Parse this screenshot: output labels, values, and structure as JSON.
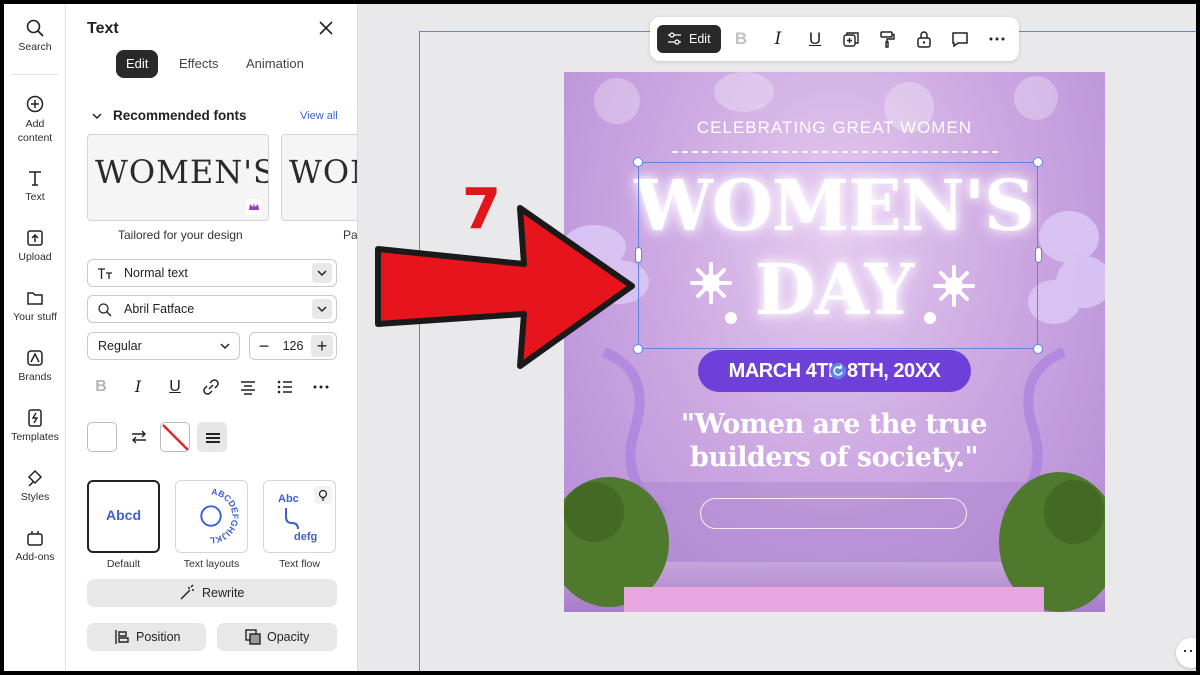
{
  "rail": {
    "items": [
      {
        "label": "Search",
        "icon": "search-icon"
      },
      {
        "label": "Add content",
        "icon": "add-content-icon"
      },
      {
        "label": "Text",
        "icon": "text-icon"
      },
      {
        "label": "Upload",
        "icon": "upload-icon"
      },
      {
        "label": "Your stuff",
        "icon": "folder-icon"
      },
      {
        "label": "Brands",
        "icon": "brands-icon"
      },
      {
        "label": "Templates",
        "icon": "templates-icon"
      },
      {
        "label": "Styles",
        "icon": "styles-icon"
      },
      {
        "label": "Add-ons",
        "icon": "add-ons-icon"
      }
    ]
  },
  "panel": {
    "title": "Text",
    "tabs": [
      "Edit",
      "Effects",
      "Animation"
    ],
    "active_tab": "Edit",
    "recommended_header": "Recommended fonts",
    "view_all": "View all",
    "font_cards": [
      {
        "sample": "WOMEN'S D",
        "label": "Tailored for your design"
      },
      {
        "sample": "WOM",
        "label": "Pa"
      }
    ],
    "text_type": "Normal text",
    "font_family": "Abril Fatface",
    "font_weight": "Regular",
    "font_size": "126",
    "presets": [
      {
        "label": "Default",
        "preview": "Abcd"
      },
      {
        "label": "Text layouts",
        "preview": "ABCDEFGHIJKL"
      },
      {
        "label": "Text flow",
        "preview_top": "Abc",
        "preview_bottom": "defg"
      }
    ],
    "rewrite_label": "Rewrite",
    "position_label": "Position",
    "opacity_label": "Opacity"
  },
  "toolbar": {
    "edit_label": "Edit"
  },
  "poster": {
    "headline": "CELEBRATING GREAT WOMEN",
    "title_line1": "WOMEN'S",
    "title_line2": "DAY",
    "date": "MARCH 4TH 8TH, 20XX",
    "quote_line1": "\"Women are the true",
    "quote_line2": "builders of society.\""
  },
  "annotation": {
    "step_number": "7"
  },
  "colors": {
    "accent_blue": "#5b86e5",
    "dark_button": "#292929",
    "annotation_red": "#e1161b",
    "poster_purple": "#cda9e2",
    "date_pill": "#6f3fd9"
  }
}
